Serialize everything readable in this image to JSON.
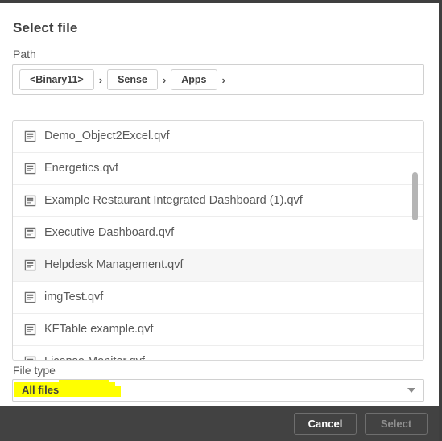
{
  "dialog": {
    "title": "Select file"
  },
  "path": {
    "label": "Path",
    "separator": "›",
    "crumbs": [
      {
        "label": "<Binary11>"
      },
      {
        "label": "Sense"
      },
      {
        "label": "Apps"
      }
    ]
  },
  "file_list": {
    "icon_name": "document-icon",
    "items": [
      {
        "name": "Demo_Object2Excel.qvf",
        "hovered": false
      },
      {
        "name": "Energetics.qvf",
        "hovered": false
      },
      {
        "name": "Example Restaurant Integrated Dashboard (1).qvf",
        "hovered": false
      },
      {
        "name": "Executive Dashboard.qvf",
        "hovered": false
      },
      {
        "name": "Helpdesk Management.qvf",
        "hovered": true
      },
      {
        "name": "imgTest.qvf",
        "hovered": false
      },
      {
        "name": "KFTable example.qvf",
        "hovered": false
      },
      {
        "name": "License Monitor.qvf",
        "hovered": false
      }
    ]
  },
  "file_type": {
    "label": "File type",
    "selected": "All files",
    "highlight_color": "#ffff00"
  },
  "footer": {
    "cancel_label": "Cancel",
    "select_label": "Select"
  }
}
